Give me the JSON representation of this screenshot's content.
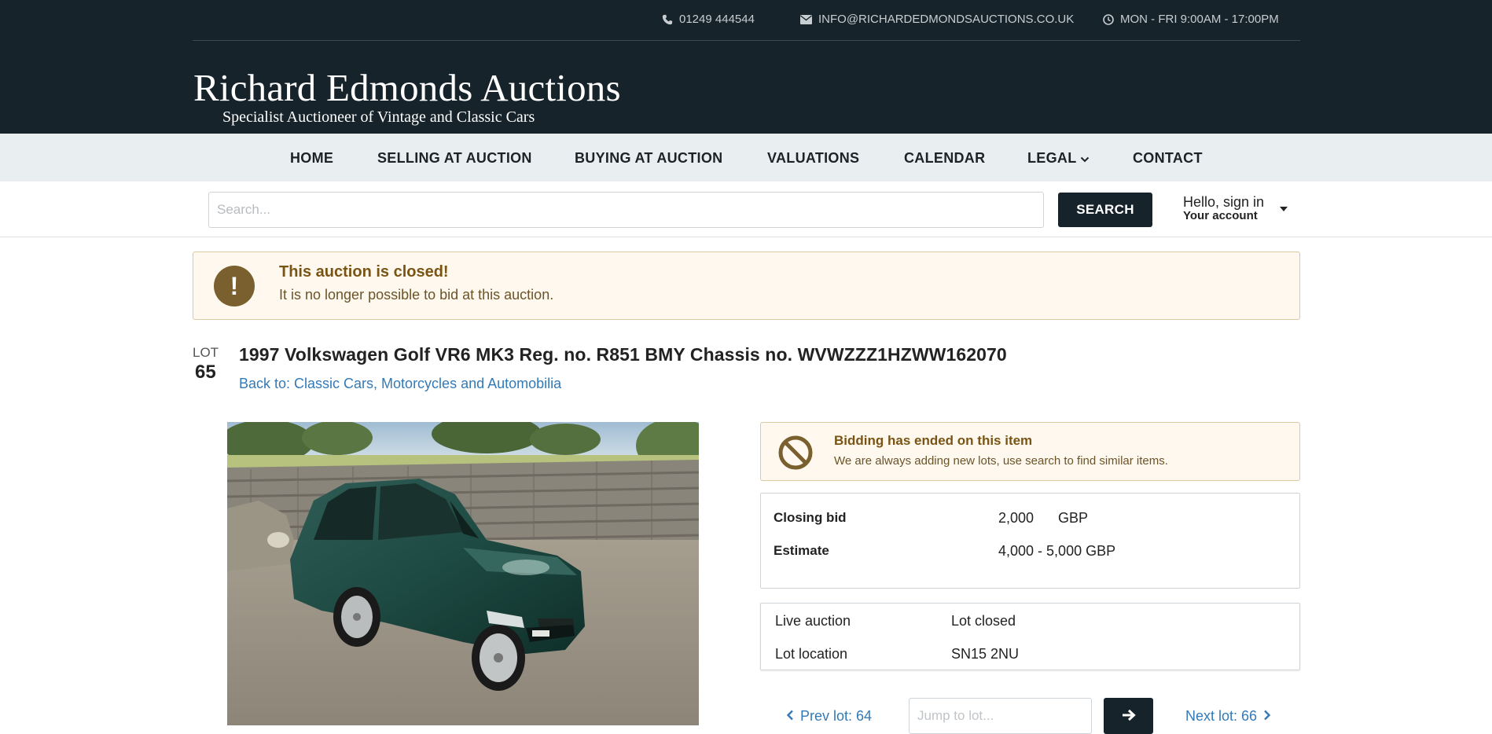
{
  "contact": {
    "phone": "01249 444544",
    "email": "INFO@RICHARDEDMONDSAUCTIONS.CO.UK",
    "hours": "MON - FRI 9:00AM - 17:00PM"
  },
  "logo": {
    "title": "Richard Edmonds Auctions",
    "subtitle": "Specialist Auctioneer of Vintage and Classic Cars"
  },
  "nav": {
    "items": [
      {
        "label": "HOME"
      },
      {
        "label": "SELLING AT AUCTION"
      },
      {
        "label": "BUYING AT AUCTION"
      },
      {
        "label": "VALUATIONS"
      },
      {
        "label": "CALENDAR"
      },
      {
        "label": "LEGAL"
      },
      {
        "label": "CONTACT"
      }
    ]
  },
  "search": {
    "placeholder": "Search...",
    "button_label": "SEARCH"
  },
  "account": {
    "greeting": "Hello, sign in",
    "label": "Your account"
  },
  "closed_alert": {
    "title": "This auction is closed!",
    "text": "It is no longer possible to bid at this auction."
  },
  "lot": {
    "label": "LOT",
    "number": "65",
    "title": "1997 Volkswagen Golf VR6 MK3 Reg. no. R851 BMY Chassis no. WVWZZZ1HZWW162070",
    "back_link": "Back to: Classic Cars, Motorcycles and Automobilia"
  },
  "bidding_ended": {
    "title": "Bidding has ended on this item",
    "text": "We are always adding new lots, use search to find similar items."
  },
  "price": {
    "closing_bid_label": "Closing bid",
    "closing_bid_value": "2,000",
    "closing_bid_currency": "GBP",
    "estimate_label": "Estimate",
    "estimate_value": "4,000 - 5,000 GBP"
  },
  "info": {
    "live_auction_label": "Live auction",
    "live_auction_value": "Lot closed",
    "location_label": "Lot location",
    "location_value": "SN15 2NU"
  },
  "pager": {
    "prev_label": "Prev lot: 64",
    "jump_placeholder": "Jump to lot...",
    "next_label": "Next lot: 66"
  },
  "colors": {
    "header_bg": "#16232b",
    "nav_bg": "#e9eef1",
    "alert_bg": "#fef8ee",
    "alert_text": "#7a5415",
    "link": "#337ab7"
  }
}
